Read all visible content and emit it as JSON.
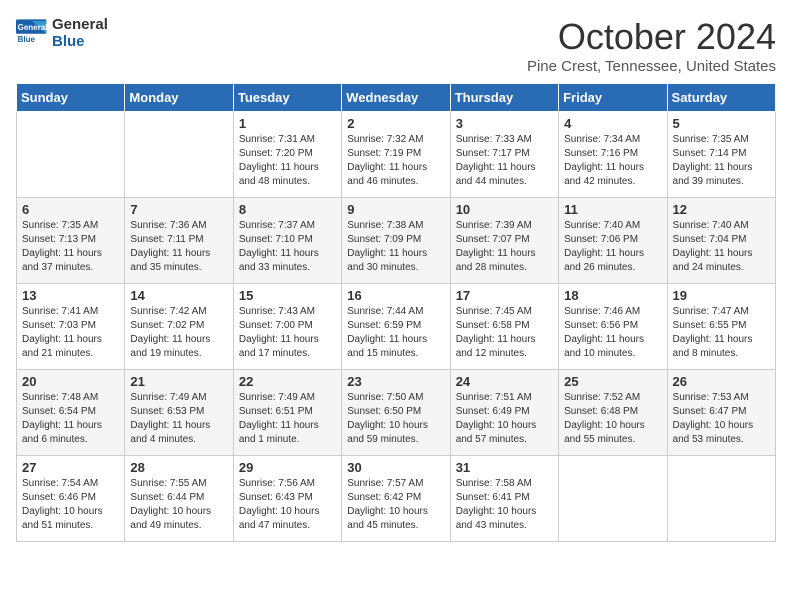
{
  "logo": {
    "line1": "General",
    "line2": "Blue"
  },
  "title": "October 2024",
  "subtitle": "Pine Crest, Tennessee, United States",
  "days_of_week": [
    "Sunday",
    "Monday",
    "Tuesday",
    "Wednesday",
    "Thursday",
    "Friday",
    "Saturday"
  ],
  "weeks": [
    [
      {
        "day": "",
        "info": ""
      },
      {
        "day": "",
        "info": ""
      },
      {
        "day": "1",
        "info": "Sunrise: 7:31 AM\nSunset: 7:20 PM\nDaylight: 11 hours and 48 minutes."
      },
      {
        "day": "2",
        "info": "Sunrise: 7:32 AM\nSunset: 7:19 PM\nDaylight: 11 hours and 46 minutes."
      },
      {
        "day": "3",
        "info": "Sunrise: 7:33 AM\nSunset: 7:17 PM\nDaylight: 11 hours and 44 minutes."
      },
      {
        "day": "4",
        "info": "Sunrise: 7:34 AM\nSunset: 7:16 PM\nDaylight: 11 hours and 42 minutes."
      },
      {
        "day": "5",
        "info": "Sunrise: 7:35 AM\nSunset: 7:14 PM\nDaylight: 11 hours and 39 minutes."
      }
    ],
    [
      {
        "day": "6",
        "info": "Sunrise: 7:35 AM\nSunset: 7:13 PM\nDaylight: 11 hours and 37 minutes."
      },
      {
        "day": "7",
        "info": "Sunrise: 7:36 AM\nSunset: 7:11 PM\nDaylight: 11 hours and 35 minutes."
      },
      {
        "day": "8",
        "info": "Sunrise: 7:37 AM\nSunset: 7:10 PM\nDaylight: 11 hours and 33 minutes."
      },
      {
        "day": "9",
        "info": "Sunrise: 7:38 AM\nSunset: 7:09 PM\nDaylight: 11 hours and 30 minutes."
      },
      {
        "day": "10",
        "info": "Sunrise: 7:39 AM\nSunset: 7:07 PM\nDaylight: 11 hours and 28 minutes."
      },
      {
        "day": "11",
        "info": "Sunrise: 7:40 AM\nSunset: 7:06 PM\nDaylight: 11 hours and 26 minutes."
      },
      {
        "day": "12",
        "info": "Sunrise: 7:40 AM\nSunset: 7:04 PM\nDaylight: 11 hours and 24 minutes."
      }
    ],
    [
      {
        "day": "13",
        "info": "Sunrise: 7:41 AM\nSunset: 7:03 PM\nDaylight: 11 hours and 21 minutes."
      },
      {
        "day": "14",
        "info": "Sunrise: 7:42 AM\nSunset: 7:02 PM\nDaylight: 11 hours and 19 minutes."
      },
      {
        "day": "15",
        "info": "Sunrise: 7:43 AM\nSunset: 7:00 PM\nDaylight: 11 hours and 17 minutes."
      },
      {
        "day": "16",
        "info": "Sunrise: 7:44 AM\nSunset: 6:59 PM\nDaylight: 11 hours and 15 minutes."
      },
      {
        "day": "17",
        "info": "Sunrise: 7:45 AM\nSunset: 6:58 PM\nDaylight: 11 hours and 12 minutes."
      },
      {
        "day": "18",
        "info": "Sunrise: 7:46 AM\nSunset: 6:56 PM\nDaylight: 11 hours and 10 minutes."
      },
      {
        "day": "19",
        "info": "Sunrise: 7:47 AM\nSunset: 6:55 PM\nDaylight: 11 hours and 8 minutes."
      }
    ],
    [
      {
        "day": "20",
        "info": "Sunrise: 7:48 AM\nSunset: 6:54 PM\nDaylight: 11 hours and 6 minutes."
      },
      {
        "day": "21",
        "info": "Sunrise: 7:49 AM\nSunset: 6:53 PM\nDaylight: 11 hours and 4 minutes."
      },
      {
        "day": "22",
        "info": "Sunrise: 7:49 AM\nSunset: 6:51 PM\nDaylight: 11 hours and 1 minute."
      },
      {
        "day": "23",
        "info": "Sunrise: 7:50 AM\nSunset: 6:50 PM\nDaylight: 10 hours and 59 minutes."
      },
      {
        "day": "24",
        "info": "Sunrise: 7:51 AM\nSunset: 6:49 PM\nDaylight: 10 hours and 57 minutes."
      },
      {
        "day": "25",
        "info": "Sunrise: 7:52 AM\nSunset: 6:48 PM\nDaylight: 10 hours and 55 minutes."
      },
      {
        "day": "26",
        "info": "Sunrise: 7:53 AM\nSunset: 6:47 PM\nDaylight: 10 hours and 53 minutes."
      }
    ],
    [
      {
        "day": "27",
        "info": "Sunrise: 7:54 AM\nSunset: 6:46 PM\nDaylight: 10 hours and 51 minutes."
      },
      {
        "day": "28",
        "info": "Sunrise: 7:55 AM\nSunset: 6:44 PM\nDaylight: 10 hours and 49 minutes."
      },
      {
        "day": "29",
        "info": "Sunrise: 7:56 AM\nSunset: 6:43 PM\nDaylight: 10 hours and 47 minutes."
      },
      {
        "day": "30",
        "info": "Sunrise: 7:57 AM\nSunset: 6:42 PM\nDaylight: 10 hours and 45 minutes."
      },
      {
        "day": "31",
        "info": "Sunrise: 7:58 AM\nSunset: 6:41 PM\nDaylight: 10 hours and 43 minutes."
      },
      {
        "day": "",
        "info": ""
      },
      {
        "day": "",
        "info": ""
      }
    ]
  ]
}
